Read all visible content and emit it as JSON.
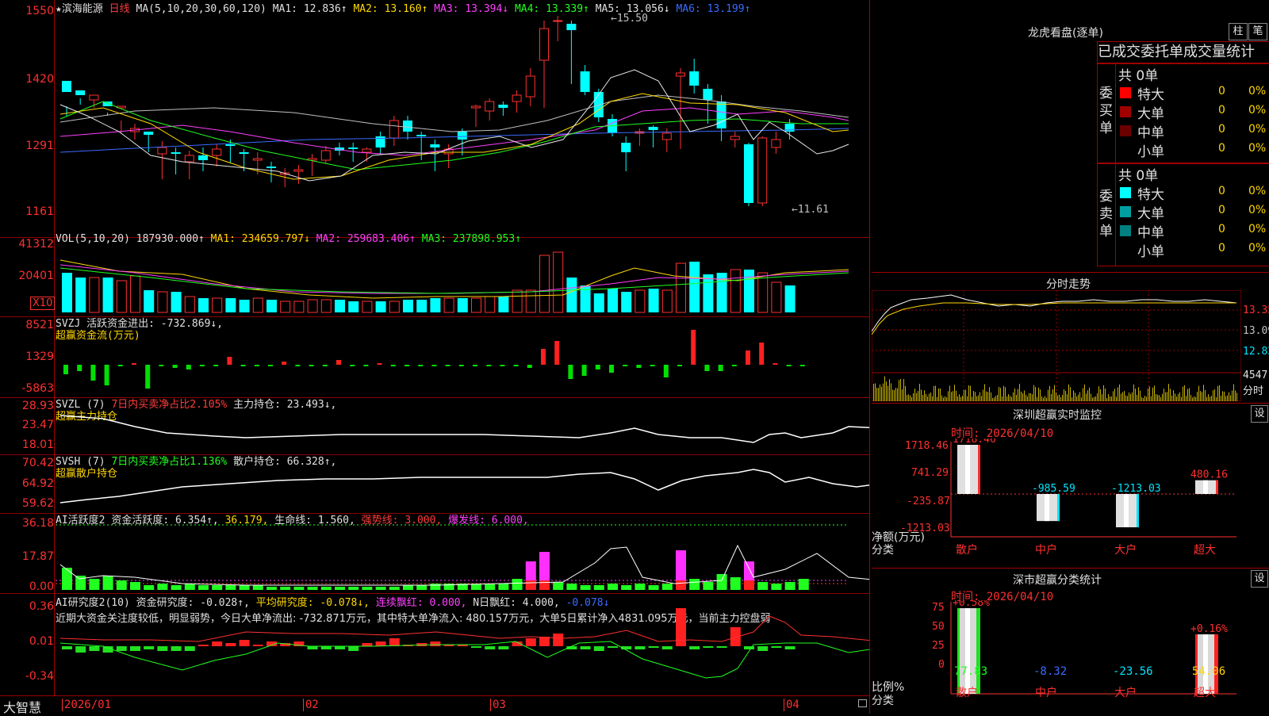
{
  "stock": {
    "name": "★滨海能源",
    "period": "日线",
    "ma_label": "MA(5,10,20,30,60,120)"
  },
  "ma_values": {
    "ma1": "MA1: 12.836↑",
    "ma2": "MA2: 13.160↑",
    "ma3": "MA3: 13.394↓",
    "ma4": "MA4: 13.339↑",
    "ma5": "MA5: 13.056↓",
    "ma6": "MA6: 13.199↑"
  },
  "price_axis": [
    "1550",
    "1420",
    "1291",
    "1161"
  ],
  "price_annotations": {
    "high": "←15.50",
    "low": "←11.61"
  },
  "vol": {
    "label": "VOL(5,10,20)",
    "value": "187930.000↑",
    "ma1": "MA1: 234659.797↓",
    "ma2": "MA2: 259683.406↑",
    "ma3": "MA3: 237898.953↑",
    "axis": [
      "41312",
      "20401"
    ],
    "unit": "X10"
  },
  "svzj": {
    "label": "SVZJ",
    "text": "活跃资金进出: -732.869↓,",
    "sub": "超赢资金流(万元)",
    "axis": [
      "8521",
      "1329",
      "-5863"
    ]
  },
  "svzl": {
    "label": "SVZL (7)",
    "text": "7日内买卖净占比2.105%",
    "text2": "主力持仓: 23.493↓,",
    "sub": "超赢主力持仓",
    "axis": [
      "28.93",
      "23.47",
      "18.01"
    ]
  },
  "svsh": {
    "label": "SVSH (7)",
    "text": "7日内买卖净占比1.136%",
    "text2": "散户持仓: 66.328↑,",
    "sub": "超赢散户持仓",
    "axis": [
      "70.42",
      "64.92",
      "59.62"
    ]
  },
  "ai_active": {
    "label": "AI活跃度2",
    "t1": "资金活跃度: 6.354↑,",
    "t2": "36.179,",
    "t3": "生命线: 1.560,",
    "t4": "强势线: 3.000,",
    "t5": "爆发线: 6.000,",
    "axis": [
      "36.18",
      "17.87",
      "0.00"
    ]
  },
  "ai_research": {
    "label": "AI研究度2(10)",
    "t1": "资金研究度: -0.028↑,",
    "t2": "平均研究度: -0.078↓,",
    "t3": "连续飘红: 0.000,",
    "t4": "N日飘红: 4.000,",
    "t5": "-0.078↓",
    "comment": "近期大资金关注度较低，明显弱势，今日大单净流出: -732.871万元，其中特大单净流入: 480.157万元，大单5日累计净入4831.095万元，当前主力控盘弱",
    "axis": [
      "0.36",
      "0.01",
      "-0.34"
    ]
  },
  "x_axis": {
    "brand": "大智慧",
    "labels": [
      "2026/01",
      "02",
      "03",
      "04"
    ]
  },
  "dragon": {
    "title": "龙虎看盘(逐单)",
    "btn1": "柱",
    "btn2": "笔",
    "tabs": [
      "已成交委托单成交量统计"
    ],
    "buy": {
      "side": "委买单",
      "total": "共 0单",
      "rows": [
        {
          "label": "特大",
          "count": "0",
          "pct": "0%",
          "color": "#ff0000"
        },
        {
          "label": "大单",
          "count": "0",
          "pct": "0%",
          "color": "#a00000"
        },
        {
          "label": "中单",
          "count": "0",
          "pct": "0%",
          "color": "#6b0000"
        },
        {
          "label": "小单",
          "count": "0",
          "pct": "0%",
          "color": ""
        }
      ]
    },
    "sell": {
      "side": "委卖单",
      "total": "共 0单",
      "rows": [
        {
          "label": "特大",
          "count": "0",
          "pct": "0%",
          "color": "#00ffff"
        },
        {
          "label": "大单",
          "count": "0",
          "pct": "0%",
          "color": "#00a0a0"
        },
        {
          "label": "中单",
          "count": "0",
          "pct": "0%",
          "color": "#008080"
        },
        {
          "label": "小单",
          "count": "0",
          "pct": "0%",
          "color": ""
        }
      ]
    }
  },
  "intraday": {
    "title": "分时走势",
    "axis": [
      "13.35",
      "13.09",
      "12.83"
    ],
    "vol_axis": [
      "4547",
      "分时"
    ]
  },
  "sz_monitor": {
    "title": "深圳超赢实时监控",
    "btn": "设",
    "time": "时间: 2026/04/10",
    "axis": [
      "1718.46",
      "741.29",
      "-235.87",
      "-1213.03"
    ],
    "y_unit": "净额(万元)",
    "x_title": "分类",
    "bars": [
      {
        "cat": "散户",
        "value": 1718.46,
        "label": "1718.46"
      },
      {
        "cat": "中户",
        "value": -985.59,
        "label": "-985.59"
      },
      {
        "cat": "大户",
        "value": -1213.03,
        "label": "-1213.03"
      },
      {
        "cat": "超大",
        "value": 480.16,
        "label": "480.16"
      }
    ]
  },
  "sz_class": {
    "title": "深市超赢分类统计",
    "btn": "设",
    "time": "时间: 2026/04/10",
    "axis": [
      "75",
      "50",
      "25",
      "0"
    ],
    "y_unit": "比例%",
    "x_title": "分类",
    "bars": [
      {
        "cat": "散户",
        "value": 77.83,
        "label": "77.83",
        "delta": "+0.58%"
      },
      {
        "cat": "中户",
        "value": -8.32,
        "label": "-8.32",
        "delta": ""
      },
      {
        "cat": "大户",
        "value": -23.56,
        "label": "-23.56",
        "delta": ""
      },
      {
        "cat": "超大",
        "value": 54.06,
        "label": "54.06",
        "delta": "+0.16%"
      }
    ]
  }
}
